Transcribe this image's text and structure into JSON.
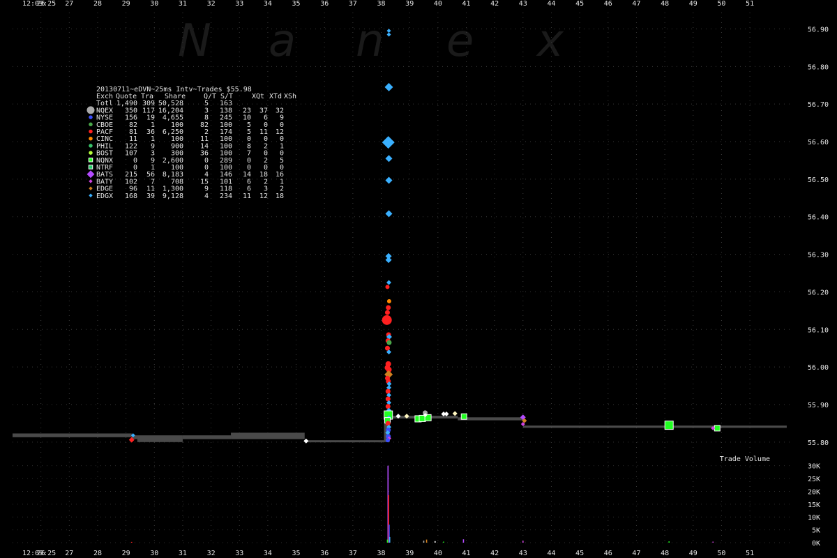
{
  "watermark": [
    "N",
    "a",
    "n",
    "e",
    "x"
  ],
  "start_time_label": "12:09:25",
  "chart_data": {
    "type": "scatter",
    "title": "20130711~eDVN~25ms Intv~Trades $55.98",
    "x_axis": {
      "unit": "seconds after 12:09",
      "start_label": "12:09:25",
      "ticks": [
        26,
        27,
        28,
        29,
        30,
        31,
        32,
        33,
        34,
        35,
        36,
        37,
        38,
        39,
        40,
        41,
        42,
        43,
        44,
        45,
        46,
        47,
        48,
        49,
        50,
        51
      ],
      "range": [
        25,
        52.4
      ]
    },
    "price_axis": {
      "ticks": [
        "55.80",
        "55.90",
        "56.00",
        "56.10",
        "56.20",
        "56.30",
        "56.40",
        "56.50",
        "56.60",
        "56.70",
        "56.80",
        "56.90"
      ],
      "range": [
        55.77,
        56.925
      ]
    },
    "volume_axis": {
      "title": "Trade Volume",
      "ticks": [
        "0K",
        "5K",
        "10K",
        "15K",
        "20K",
        "25K",
        "30K"
      ],
      "range": [
        0,
        31000
      ]
    },
    "legend": {
      "header": [
        "Exch",
        "Quote",
        "Tra",
        "Share",
        "Q/T",
        "S/T",
        "XQt",
        "XTd",
        "XSh"
      ],
      "rows": [
        {
          "name": "Totl",
          "marker": "none",
          "color": "",
          "values": [
            "1,490",
            "309",
            "50,528",
            "5",
            "163",
            "",
            "",
            ""
          ]
        },
        {
          "name": "NQEX",
          "marker": "circle",
          "color": "#aaaaaa",
          "values": [
            "350",
            "117",
            "16,204",
            "3",
            "138",
            "23",
            "37",
            "32"
          ]
        },
        {
          "name": "NYSE",
          "marker": "circle",
          "color": "#3a4dff",
          "values": [
            "156",
            "19",
            "4,655",
            "8",
            "245",
            "10",
            "6",
            "9"
          ]
        },
        {
          "name": "CBOE",
          "marker": "circle",
          "color": "#4aa84a",
          "values": [
            "82",
            "1",
            "100",
            "82",
            "100",
            "5",
            "0",
            "0"
          ]
        },
        {
          "name": "PACF",
          "marker": "circle",
          "color": "#ff2020",
          "values": [
            "81",
            "36",
            "6,250",
            "2",
            "174",
            "5",
            "11",
            "12"
          ]
        },
        {
          "name": "CINC",
          "marker": "circle",
          "color": "#ff8a00",
          "values": [
            "11",
            "1",
            "100",
            "11",
            "100",
            "0",
            "0",
            "0"
          ]
        },
        {
          "name": "PHIL",
          "marker": "circle",
          "color": "#39c26a",
          "values": [
            "122",
            "9",
            "900",
            "14",
            "100",
            "8",
            "2",
            "1"
          ]
        },
        {
          "name": "BOST",
          "marker": "circle",
          "color": "#b6ff3a",
          "values": [
            "107",
            "3",
            "300",
            "36",
            "100",
            "7",
            "0",
            "0"
          ]
        },
        {
          "name": "NQNX",
          "marker": "square",
          "color": "#22ff22",
          "values": [
            "0",
            "9",
            "2,600",
            "0",
            "289",
            "0",
            "2",
            "5"
          ]
        },
        {
          "name": "NTRF",
          "marker": "square",
          "color": "#22cc66",
          "values": [
            "0",
            "1",
            "100",
            "0",
            "100",
            "0",
            "0",
            "0"
          ]
        },
        {
          "name": "BATS",
          "marker": "diamond",
          "color": "#b44bff",
          "values": [
            "215",
            "56",
            "8,183",
            "4",
            "146",
            "14",
            "18",
            "16"
          ]
        },
        {
          "name": "BATY",
          "marker": "diamond",
          "color": "#d044e0",
          "values": [
            "102",
            "7",
            "708",
            "15",
            "101",
            "6",
            "2",
            "1"
          ]
        },
        {
          "name": "EDGE",
          "marker": "diamond",
          "color": "#d08020",
          "values": [
            "96",
            "11",
            "1,300",
            "9",
            "118",
            "6",
            "3",
            "2"
          ]
        },
        {
          "name": "EDGX",
          "marker": "diamond",
          "color": "#3ab0ff",
          "values": [
            "168",
            "39",
            "9,128",
            "4",
            "234",
            "11",
            "12",
            "18"
          ]
        }
      ]
    },
    "series": [
      {
        "name": "NBBO",
        "type": "step",
        "color": "#4a4a4a",
        "segments": [
          {
            "x0": 25.0,
            "x1": 29.2,
            "y0": 55.813,
            "y1": 55.823
          },
          {
            "x0": 29.2,
            "x1": 29.4,
            "y0": 55.808,
            "y1": 55.818
          },
          {
            "x0": 29.4,
            "x1": 31.0,
            "y0": 55.8,
            "y1": 55.818
          },
          {
            "x0": 31.0,
            "x1": 32.7,
            "y0": 55.808,
            "y1": 55.818
          },
          {
            "x0": 32.7,
            "x1": 35.3,
            "y0": 55.808,
            "y1": 55.825
          },
          {
            "x0": 35.3,
            "x1": 38.1,
            "y0": 55.8,
            "y1": 55.805
          },
          {
            "x0": 38.3,
            "x1": 40.7,
            "y0": 55.863,
            "y1": 55.87
          },
          {
            "x0": 40.7,
            "x1": 43.0,
            "y0": 55.858,
            "y1": 55.866
          },
          {
            "x0": 43.0,
            "x1": 52.3,
            "y0": 55.838,
            "y1": 55.844
          }
        ]
      },
      {
        "name": "Trades",
        "type": "scatter",
        "points": [
          {
            "x": 38.27,
            "y": 56.895,
            "m": "diamond",
            "c": "#3ab0ff",
            "s": 6
          },
          {
            "x": 38.27,
            "y": 56.885,
            "m": "diamond",
            "c": "#3ab0ff",
            "s": 6
          },
          {
            "x": 38.27,
            "y": 56.745,
            "m": "diamond",
            "c": "#3ab0ff",
            "s": 12
          },
          {
            "x": 38.25,
            "y": 56.598,
            "m": "diamond",
            "c": "#3ab0ff",
            "s": 18
          },
          {
            "x": 38.27,
            "y": 56.555,
            "m": "diamond",
            "c": "#3ab0ff",
            "s": 10
          },
          {
            "x": 38.27,
            "y": 56.497,
            "m": "diamond",
            "c": "#3ab0ff",
            "s": 10
          },
          {
            "x": 38.27,
            "y": 56.408,
            "m": "diamond",
            "c": "#3ab0ff",
            "s": 10
          },
          {
            "x": 38.26,
            "y": 56.295,
            "m": "diamond",
            "c": "#3ab0ff",
            "s": 9
          },
          {
            "x": 38.26,
            "y": 56.285,
            "m": "diamond",
            "c": "#3ab0ff",
            "s": 9
          },
          {
            "x": 38.27,
            "y": 56.225,
            "m": "diamond",
            "c": "#3ab0ff",
            "s": 7
          },
          {
            "x": 38.22,
            "y": 56.213,
            "m": "circle",
            "c": "#ff2020",
            "s": 6
          },
          {
            "x": 38.28,
            "y": 56.175,
            "m": "circle",
            "c": "#ff8a00",
            "s": 6
          },
          {
            "x": 38.25,
            "y": 56.158,
            "m": "circle",
            "c": "#ff2020",
            "s": 7
          },
          {
            "x": 38.22,
            "y": 56.145,
            "m": "circle",
            "c": "#ff2020",
            "s": 7
          },
          {
            "x": 38.2,
            "y": 56.125,
            "m": "circle",
            "c": "#ff2020",
            "s": 14
          },
          {
            "x": 38.26,
            "y": 56.086,
            "m": "circle",
            "c": "#ff2020",
            "s": 7
          },
          {
            "x": 38.28,
            "y": 56.08,
            "m": "diamond",
            "c": "#3ab0ff",
            "s": 8
          },
          {
            "x": 38.24,
            "y": 56.07,
            "m": "circle",
            "c": "#ff2020",
            "s": 7
          },
          {
            "x": 38.28,
            "y": 56.065,
            "m": "circle",
            "c": "#4aa84a",
            "s": 7
          },
          {
            "x": 38.22,
            "y": 56.05,
            "m": "circle",
            "c": "#ff2020",
            "s": 7
          },
          {
            "x": 38.27,
            "y": 56.04,
            "m": "diamond",
            "c": "#3ab0ff",
            "s": 7
          },
          {
            "x": 38.25,
            "y": 56.008,
            "m": "circle",
            "c": "#ff2020",
            "s": 8
          },
          {
            "x": 38.22,
            "y": 55.998,
            "m": "circle",
            "c": "#ff2020",
            "s": 8
          },
          {
            "x": 38.27,
            "y": 55.993,
            "m": "circle",
            "c": "#ff2020",
            "s": 8
          },
          {
            "x": 38.26,
            "y": 55.98,
            "m": "diamond",
            "c": "#d08020",
            "s": 12
          },
          {
            "x": 38.22,
            "y": 55.97,
            "m": "circle",
            "c": "#ff2020",
            "s": 7
          },
          {
            "x": 38.25,
            "y": 55.962,
            "m": "circle",
            "c": "#ff2020",
            "s": 7
          },
          {
            "x": 38.28,
            "y": 55.955,
            "m": "diamond",
            "c": "#3ab0ff",
            "s": 7
          },
          {
            "x": 38.27,
            "y": 55.945,
            "m": "diamond",
            "c": "#3ab0ff",
            "s": 7
          },
          {
            "x": 38.24,
            "y": 55.935,
            "m": "circle",
            "c": "#ff2020",
            "s": 7
          },
          {
            "x": 38.27,
            "y": 55.925,
            "m": "diamond",
            "c": "#3ab0ff",
            "s": 7
          },
          {
            "x": 38.24,
            "y": 55.915,
            "m": "circle",
            "c": "#ff2020",
            "s": 7
          },
          {
            "x": 38.27,
            "y": 55.905,
            "m": "diamond",
            "c": "#3ab0ff",
            "s": 7
          },
          {
            "x": 38.24,
            "y": 55.895,
            "m": "circle",
            "c": "#ff2020",
            "s": 7
          },
          {
            "x": 38.27,
            "y": 55.885,
            "m": "diamond",
            "c": "#3ab0ff",
            "s": 7
          },
          {
            "x": 38.25,
            "y": 55.872,
            "m": "square",
            "c": "#22ff22",
            "s": 12
          },
          {
            "x": 38.27,
            "y": 55.865,
            "m": "diamond",
            "c": "#3ab0ff",
            "s": 7
          },
          {
            "x": 38.22,
            "y": 55.858,
            "m": "square",
            "c": "#22ff22",
            "s": 8
          },
          {
            "x": 38.24,
            "y": 55.85,
            "m": "circle",
            "c": "#ff2020",
            "s": 7
          },
          {
            "x": 38.27,
            "y": 55.84,
            "m": "diamond",
            "c": "#3ab0ff",
            "s": 7
          },
          {
            "x": 38.25,
            "y": 55.832,
            "m": "circle",
            "c": "#3a4dff",
            "s": 7
          },
          {
            "x": 38.23,
            "y": 55.825,
            "m": "diamond",
            "c": "#3ab0ff",
            "s": 7
          },
          {
            "x": 38.25,
            "y": 55.815,
            "m": "circle",
            "c": "#3a4dff",
            "s": 7
          },
          {
            "x": 38.28,
            "y": 55.81,
            "m": "diamond",
            "c": "#d044e0",
            "s": 6
          },
          {
            "x": 38.23,
            "y": 55.805,
            "m": "circle",
            "c": "#3a4dff",
            "s": 6
          },
          {
            "x": 38.6,
            "y": 55.869,
            "m": "diamond",
            "c": "#ffffff",
            "s": 7
          },
          {
            "x": 38.9,
            "y": 55.869,
            "m": "diamond",
            "c": "#fff7c0",
            "s": 7
          },
          {
            "x": 39.3,
            "y": 55.862,
            "m": "square",
            "c": "#22ff22",
            "s": 9
          },
          {
            "x": 39.45,
            "y": 55.863,
            "m": "square",
            "c": "#22ff22",
            "s": 9
          },
          {
            "x": 39.55,
            "y": 55.878,
            "m": "circle",
            "c": "#aaaaaa",
            "s": 7
          },
          {
            "x": 39.65,
            "y": 55.865,
            "m": "square",
            "c": "#22ff22",
            "s": 9
          },
          {
            "x": 39.55,
            "y": 55.872,
            "m": "diamond",
            "c": "#ffffff",
            "s": 6
          },
          {
            "x": 40.2,
            "y": 55.875,
            "m": "diamond",
            "c": "#ffffff",
            "s": 7
          },
          {
            "x": 40.3,
            "y": 55.875,
            "m": "diamond",
            "c": "#ffffff",
            "s": 7
          },
          {
            "x": 40.6,
            "y": 55.876,
            "m": "diamond",
            "c": "#fff7c0",
            "s": 7
          },
          {
            "x": 40.92,
            "y": 55.868,
            "m": "square",
            "c": "#22ff22",
            "s": 8
          },
          {
            "x": 43.0,
            "y": 55.866,
            "m": "diamond",
            "c": "#b44bff",
            "s": 8
          },
          {
            "x": 43.05,
            "y": 55.857,
            "m": "diamond",
            "c": "#d08020",
            "s": 7
          },
          {
            "x": 43.0,
            "y": 55.848,
            "m": "diamond",
            "c": "#d044e0",
            "s": 6
          },
          {
            "x": 29.2,
            "y": 55.806,
            "m": "diamond",
            "c": "#ff2020",
            "s": 8
          },
          {
            "x": 29.25,
            "y": 55.818,
            "m": "diamond",
            "c": "#3ab0ff",
            "s": 6
          },
          {
            "x": 35.35,
            "y": 55.803,
            "m": "diamond",
            "c": "#ffffff",
            "s": 7
          },
          {
            "x": 48.15,
            "y": 55.845,
            "m": "square",
            "c": "#22ff22",
            "s": 12
          },
          {
            "x": 49.85,
            "y": 55.837,
            "m": "square",
            "c": "#22ff22",
            "s": 8
          },
          {
            "x": 49.7,
            "y": 55.837,
            "m": "diamond",
            "c": "#d044e0",
            "s": 6
          }
        ]
      },
      {
        "name": "Trade Volume",
        "type": "bar",
        "bars": [
          {
            "x": 38.24,
            "v": 30000,
            "c": "#b44bff"
          },
          {
            "x": 38.26,
            "v": 18500,
            "c": "#ff2020"
          },
          {
            "x": 38.28,
            "v": 7000,
            "c": "#3a4dff"
          },
          {
            "x": 38.3,
            "v": 2200,
            "c": "#3ab0ff"
          },
          {
            "x": 38.22,
            "v": 1200,
            "c": "#22ff22"
          },
          {
            "x": 29.2,
            "v": 300,
            "c": "#ff2020"
          },
          {
            "x": 39.5,
            "v": 800,
            "c": "#aaaaaa"
          },
          {
            "x": 39.6,
            "v": 1200,
            "c": "#d08020"
          },
          {
            "x": 39.9,
            "v": 600,
            "c": "#ffffff"
          },
          {
            "x": 40.2,
            "v": 400,
            "c": "#22ff22"
          },
          {
            "x": 40.9,
            "v": 1300,
            "c": "#b44bff"
          },
          {
            "x": 43.0,
            "v": 700,
            "c": "#d044e0"
          },
          {
            "x": 48.15,
            "v": 500,
            "c": "#22ff22"
          },
          {
            "x": 49.7,
            "v": 400,
            "c": "#d044e0"
          }
        ]
      }
    ]
  }
}
